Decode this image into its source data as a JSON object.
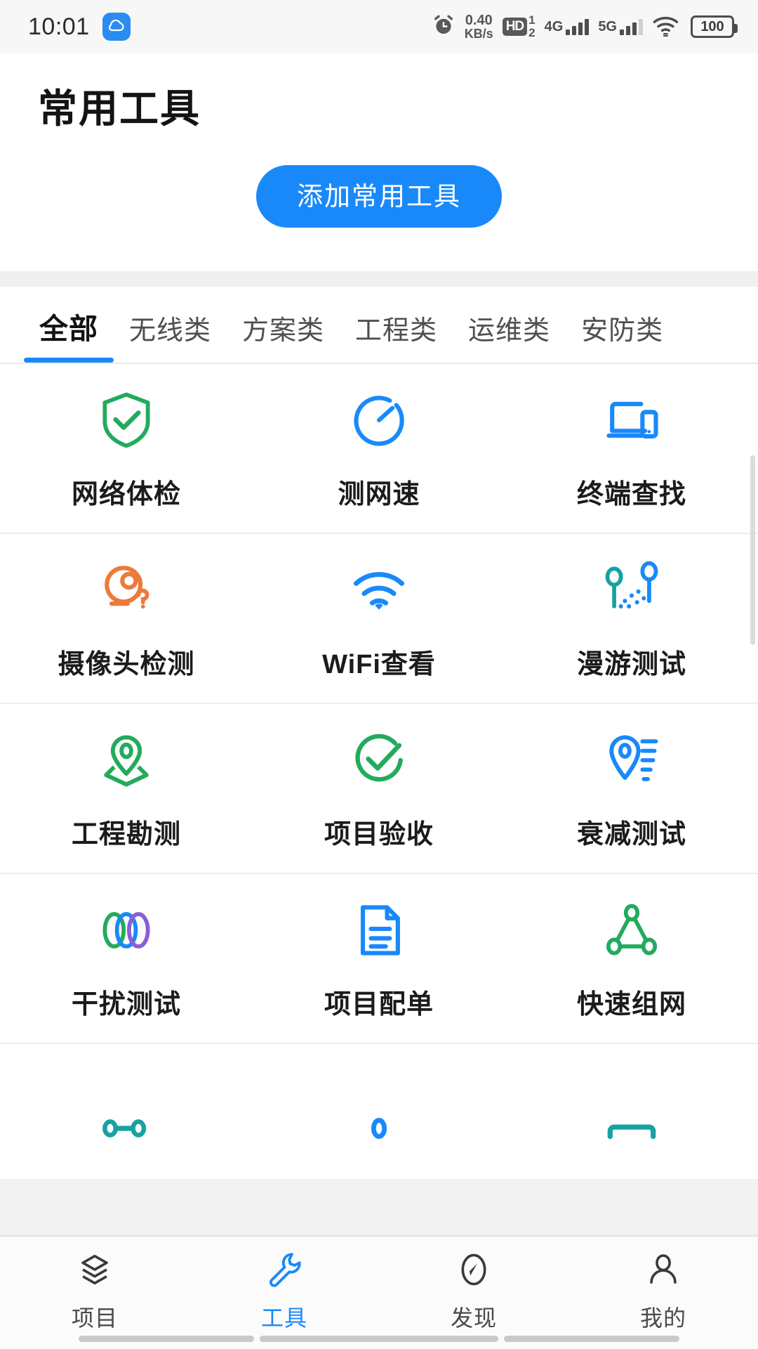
{
  "status_bar": {
    "time": "10:01",
    "app_badge_icon": "cloud-icon",
    "alarm_icon": "alarm-clock-icon",
    "net_speed_value": "0.40",
    "net_speed_unit": "KB/s",
    "hd_label": "HD",
    "sim_top": "1",
    "sim_bottom": "2",
    "signal_1_label": "4G",
    "signal_2_label": "5G",
    "wifi_icon": "wifi-icon",
    "battery_level": "100"
  },
  "header": {
    "title": "常用工具",
    "add_button_label": "添加常用工具",
    "accent_color": "#1989fa"
  },
  "tabs": [
    {
      "label": "全部",
      "active": true
    },
    {
      "label": "无线类",
      "active": false
    },
    {
      "label": "方案类",
      "active": false
    },
    {
      "label": "工程类",
      "active": false
    },
    {
      "label": "运维类",
      "active": false
    },
    {
      "label": "安防类",
      "active": false
    }
  ],
  "tools": [
    {
      "label": "网络体检",
      "icon": "shield-check-icon",
      "color": "#22ab5c"
    },
    {
      "label": "测网速",
      "icon": "speedometer-icon",
      "color": "#1989fa"
    },
    {
      "label": "终端查找",
      "icon": "devices-icon",
      "color": "#1989fa"
    },
    {
      "label": "摄像头检测",
      "icon": "camera-question-icon",
      "color": "#ec7a3a"
    },
    {
      "label": "WiFi查看",
      "icon": "wifi-signal-icon",
      "color": "#1989fa"
    },
    {
      "label": "漫游测试",
      "icon": "roaming-nodes-icon",
      "color": "#17a2a2"
    },
    {
      "label": "工程勘测",
      "icon": "survey-pin-icon",
      "color": "#22ab5c"
    },
    {
      "label": "项目验收",
      "icon": "circle-check-icon",
      "color": "#22ab5c"
    },
    {
      "label": "衰减测试",
      "icon": "attenuation-pin-icon",
      "color": "#1989fa"
    },
    {
      "label": "干扰测试",
      "icon": "interference-rings-icon",
      "color": "#22ab5c"
    },
    {
      "label": "项目配单",
      "icon": "document-icon",
      "color": "#1989fa"
    },
    {
      "label": "快速组网",
      "icon": "network-triangle-icon",
      "color": "#22ab5c"
    }
  ],
  "partial_row_icons": [
    {
      "icon": "network-nodes-icon",
      "color": "#17a2a2"
    },
    {
      "icon": "location-pin-icon",
      "color": "#1989fa"
    },
    {
      "icon": "device-bar-icon",
      "color": "#17a2a2"
    }
  ],
  "bottom_nav": [
    {
      "label": "项目",
      "icon": "layers-icon",
      "active": false
    },
    {
      "label": "工具",
      "icon": "wrench-icon",
      "active": true
    },
    {
      "label": "发现",
      "icon": "compass-icon",
      "active": false
    },
    {
      "label": "我的",
      "icon": "person-icon",
      "active": false
    }
  ]
}
